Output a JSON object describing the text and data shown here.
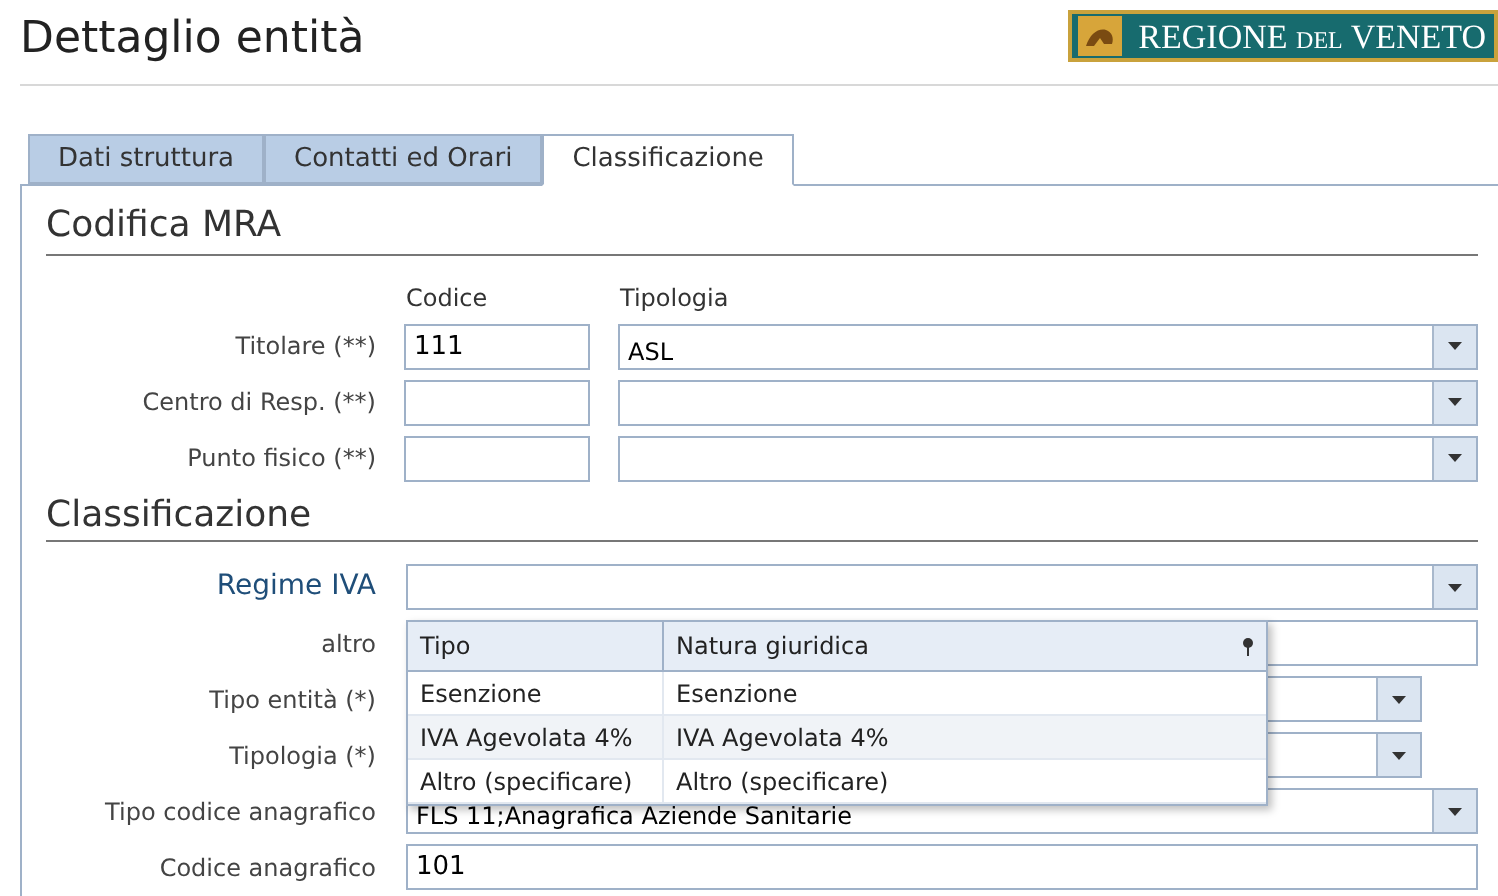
{
  "header": {
    "title": "Dettaglio entità",
    "logo": {
      "text_1": "REGIONE",
      "text_2": "DEL",
      "text_3": "VENETO"
    }
  },
  "tabs": [
    {
      "label": "Dati struttura",
      "selected": false
    },
    {
      "label": "Contatti ed Orari",
      "selected": false
    },
    {
      "label": "Classificazione",
      "selected": true
    }
  ],
  "codifica": {
    "title": "Codifica MRA",
    "columns": [
      "Codice",
      "Tipologia"
    ],
    "rows": [
      {
        "label": "Titolare (**)",
        "code": "111",
        "type": "ASL"
      },
      {
        "label": "Centro di Resp. (**)"
      },
      {
        "label": "Punto fisico (**)"
      }
    ]
  },
  "classificazione": {
    "title": "Classificazione",
    "fields": [
      {
        "label": "Regime IVA",
        "kind": "select",
        "emphasis": true,
        "wide": true
      },
      {
        "label": "altro",
        "kind": "text",
        "wide": true
      },
      {
        "label": "Tipo entità (*)",
        "kind": "select",
        "wide": false
      },
      {
        "label": "Tipologia (*)",
        "kind": "select",
        "wide": false
      },
      {
        "label": "Tipo codice anagrafico",
        "kind": "select",
        "wide": true,
        "value": "FLS 11;Anagrafica Aziende Sanitarie"
      },
      {
        "label": "Codice anagrafico",
        "kind": "text",
        "wide": true,
        "value": "101"
      }
    ]
  },
  "dropdown": {
    "columns": [
      "Tipo",
      "Natura giuridica"
    ],
    "rows": [
      {
        "tipo": "Esenzione",
        "natura": "Esenzione",
        "selected": false
      },
      {
        "tipo": "IVA Agevolata 4%",
        "natura": "IVA Agevolata 4%",
        "selected": true
      },
      {
        "tipo": "Altro (specificare)",
        "natura": "Altro (specificare)",
        "selected": false
      }
    ]
  }
}
